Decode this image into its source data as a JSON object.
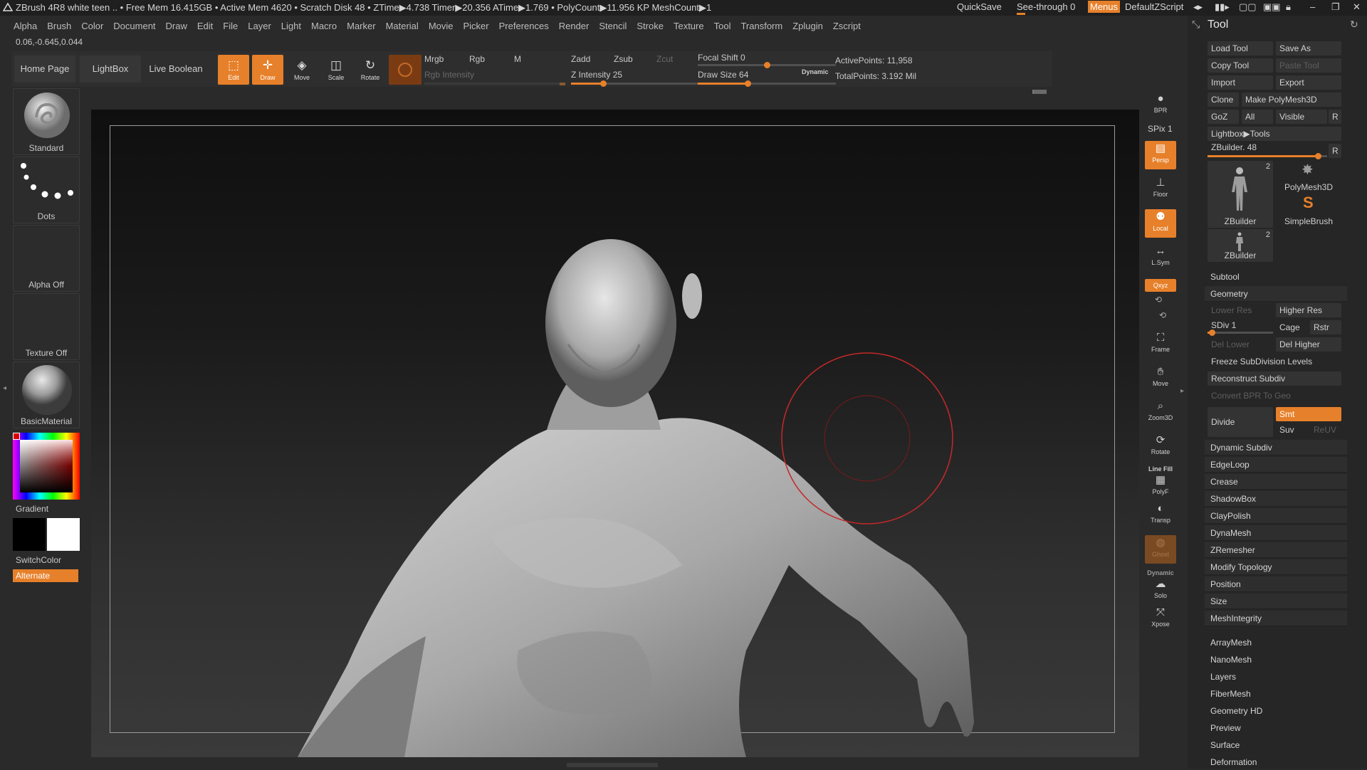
{
  "titlebar": {
    "title": "ZBrush 4R8    white teen   .. • Free Mem 16.415GB • Active Mem 4620 • Scratch Disk 48 • ZTime▶4.738 Timer▶20.356 ATime▶1.769 • PolyCount▶11.956 KP   MeshCount▶1",
    "quicksave": "QuickSave",
    "see_through": "See-through  0",
    "menus": "Menus",
    "script": "DefaultZScript"
  },
  "menubar": [
    "Alpha",
    "Brush",
    "Color",
    "Document",
    "Draw",
    "Edit",
    "File",
    "Layer",
    "Light",
    "Macro",
    "Marker",
    "Material",
    "Movie",
    "Picker",
    "Preferences",
    "Render",
    "Stencil",
    "Stroke",
    "Texture",
    "Tool",
    "Transform",
    "Zplugin",
    "Zscript"
  ],
  "coords": "0.06,-0.645,0.044",
  "toolbar": {
    "home_page": "Home Page",
    "lightbox": "LightBox",
    "live_boolean": "Live Boolean",
    "edit": "Edit",
    "draw": "Draw",
    "move": "Move",
    "scale": "Scale",
    "rotate": "Rotate",
    "mrgb": "Mrgb",
    "rgb": "Rgb",
    "m": "M",
    "rgb_intensity": "Rgb Intensity",
    "zadd": "Zadd",
    "zsub": "Zsub",
    "zcut": "Zcut",
    "z_intensity": "Z Intensity 25",
    "z_intensity_value": 0.25,
    "focal_shift": "Focal Shift 0",
    "focal_shift_value": 0.5,
    "draw_size": "Draw Size 64",
    "draw_size_value": 0.36,
    "dynamic": "Dynamic",
    "active_points": "ActivePoints: 11,958",
    "total_points": "TotalPoints: 3.192 Mil"
  },
  "leftshelf": {
    "brush": "Standard",
    "stroke": "Dots",
    "alpha": "Alpha Off",
    "texture": "Texture Off",
    "material": "BasicMaterial",
    "gradient": "Gradient",
    "switchcolor": "SwitchColor",
    "alternate": "Alternate"
  },
  "rightstrip": {
    "bpr": "BPR",
    "spix": "SPix 1",
    "persp": "Persp",
    "floor": "Floor",
    "local": "Local",
    "lsym": "L.Sym",
    "xyz": "Qxyz",
    "frame": "Frame",
    "move": "Move",
    "zoom3d": "Zoom3D",
    "rotate": "Rotate",
    "linefill": "Line Fill",
    "polyf": "PolyF",
    "transp": "Transp",
    "ghost": "Ghost",
    "dynamic": "Dynamic",
    "solo": "Solo",
    "xpose": "Xpose"
  },
  "toolpanel": {
    "title": "Tool",
    "load_tool": "Load Tool",
    "save_as": "Save As",
    "copy_tool": "Copy Tool",
    "paste_tool": "Paste Tool",
    "import": "Import",
    "export": "Export",
    "clone": "Clone",
    "make_polymesh": "Make PolyMesh3D",
    "goz": "GoZ",
    "all": "All",
    "visible": "Visible",
    "r": "R",
    "lightbox_tools": "Lightbox▶Tools",
    "zbuilder_slider": "ZBuilder. 48",
    "zbuilder_slider_value": 0.92,
    "thumb1": "ZBuilder",
    "thumb1_count": "2",
    "thumb2": "PolyMesh3D",
    "thumb3": "SimpleBrush",
    "thumb4": "ZBuilder",
    "thumb4_count": "2",
    "subtool": "Subtool",
    "geometry": "Geometry",
    "lower_res": "Lower Res",
    "higher_res": "Higher Res",
    "sdiv": "SDiv 1",
    "cage": "Cage",
    "rstr": "Rstr",
    "del_lower": "Del Lower",
    "del_higher": "Del Higher",
    "freeze": "Freeze SubDivision Levels",
    "reconstruct": "Reconstruct Subdiv",
    "convert_bpr": "Convert BPR To Geo",
    "divide": "Divide",
    "smt": "Smt",
    "suv": "Suv",
    "reuv": "ReUV",
    "geometry_items": [
      "Dynamic Subdiv",
      "EdgeLoop",
      "Crease",
      "ShadowBox",
      "ClayPolish",
      "DynaMesh",
      "ZRemesher",
      "Modify Topology",
      "Position",
      "Size",
      "MeshIntegrity"
    ],
    "sections": [
      "ArrayMesh",
      "NanoMesh",
      "Layers",
      "FiberMesh",
      "Geometry HD",
      "Preview",
      "Surface",
      "Deformation"
    ]
  }
}
